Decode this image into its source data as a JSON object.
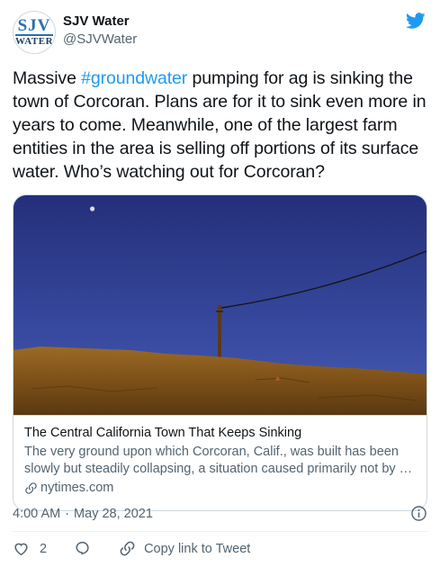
{
  "author": {
    "display_name": "SJV Water",
    "handle": "@SJVWater",
    "avatar_line1": "SJV",
    "avatar_line2": "WATER"
  },
  "tweet": {
    "text_before": "Massive ",
    "hashtag": "#groundwater",
    "text_after": " pumping for ag is sinking the town of Corcoran. Plans are for it to sink even more in years to come. Meanwhile, one of the largest farm entities in the area is selling off portions of its surface water. Who’s watching out for Corcoran?"
  },
  "card": {
    "title": "The Central California Town That Keeps Sinking",
    "description": "The very ground upon which Corcoran, Calif., was built has been slowly but steadily collapsing, a situation caused primarily not by …",
    "domain": "nytimes.com"
  },
  "meta": {
    "time": "4:00 AM",
    "separator": "·",
    "date": "May 28, 2021"
  },
  "actions": {
    "like_count": "2",
    "copy_link_label": "Copy link to Tweet"
  },
  "colors": {
    "accent": "#1d9bf0",
    "text": "#0f1419",
    "secondary": "#536471",
    "sky": "#2c3e8f",
    "ground": "#8a5a1c"
  },
  "icons": [
    "twitter-bird-icon",
    "link-icon",
    "info-icon",
    "heart-icon",
    "reply-icon",
    "copy-link-icon"
  ]
}
